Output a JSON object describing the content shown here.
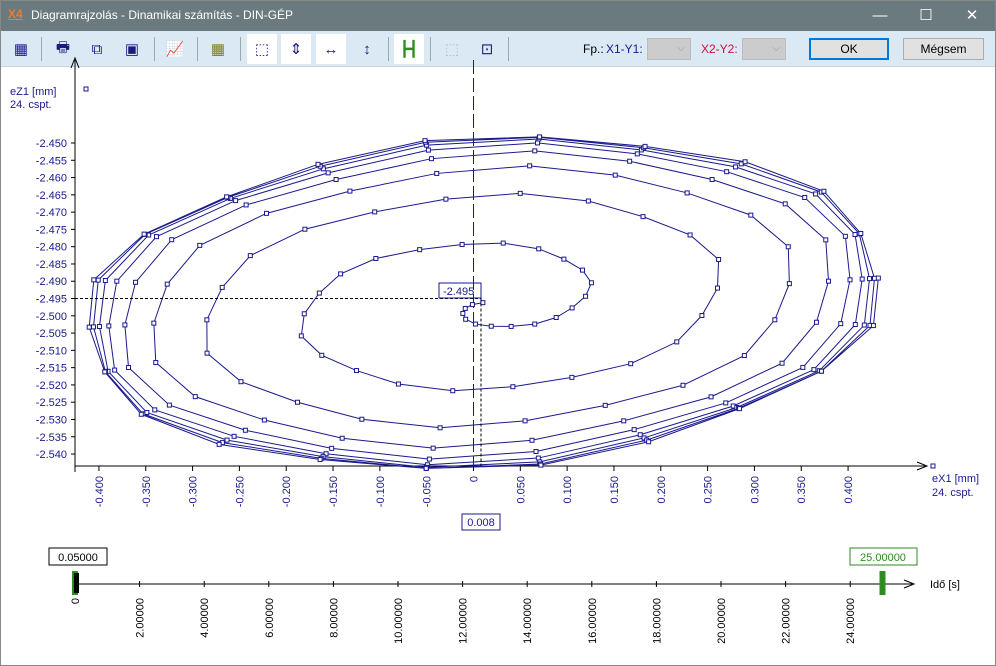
{
  "window": {
    "title": "Diagramrajzolás - Dinamikai számítás - DIN-GÉP",
    "logo": "X4",
    "minimize": "—",
    "maximize": "☐",
    "close": "✕"
  },
  "toolbar": {
    "icons": [
      "copy-icon",
      "printer-icon",
      "export-icon",
      "camera-icon",
      "chart-icon",
      "table-icon",
      "fit-both-icon",
      "fit-vertical-icon",
      "fit-horizontal-width-icon",
      "fit-vertical-height-icon",
      "time-range-icon",
      "marker-disabled-icon",
      "cursor-icon"
    ],
    "fp_label": "Fp.:",
    "x1y1_label": "X1-Y1:",
    "x2y2_label": "X2-Y2:",
    "ok": "OK",
    "cancel": "Mégsem"
  },
  "colors": {
    "series": "#1a1a8c",
    "x1y1": "#1a1a8c",
    "x2y2": "#d0103a",
    "slider": "#2e8b1f"
  },
  "chart_data": {
    "type": "line",
    "ylabel": "eZ1 [mm]",
    "ylabel_sub": "24. cspt.",
    "xlabel": "eX1 [mm]",
    "xlabel_sub": "24. cspt.",
    "xlim": [
      -0.425,
      0.445
    ],
    "ylim": [
      -2.5455,
      -2.447
    ],
    "xticks": [
      "-0.400",
      "-0.350",
      "-0.300",
      "-0.250",
      "-0.200",
      "-0.150",
      "-0.100",
      "-0.050",
      "0",
      "0.050",
      "0.100",
      "0.150",
      "0.200",
      "0.250",
      "0.300",
      "0.350",
      "0.400"
    ],
    "yticks": [
      "-2.450",
      "-2.455",
      "-2.460",
      "-2.465",
      "-2.470",
      "-2.475",
      "-2.480",
      "-2.485",
      "-2.490",
      "-2.495",
      "-2.500",
      "-2.505",
      "-2.510",
      "-2.515",
      "-2.520",
      "-2.525",
      "-2.530",
      "-2.535",
      "-2.540"
    ],
    "series": [
      {
        "model": "growing spiral to limit cycle",
        "center": [
          0.01,
          -2.4962
        ],
        "amplitude_x": 0.43,
        "amplitude_y": 0.0485,
        "points_per_turn": 22,
        "turns": 8.5,
        "growth_turns": 2.2
      }
    ],
    "cursor": {
      "x": "0.008",
      "y": "-2.495"
    }
  },
  "timeline": {
    "label": "Idő [s]",
    "start_value": "0.05000",
    "end_value": "25.00000",
    "ticks": [
      "0",
      "2.00000",
      "4.00000",
      "6.00000",
      "8.00000",
      "10.00000",
      "12.00000",
      "14.00000",
      "16.00000",
      "18.00000",
      "20.00000",
      "22.00000",
      "24.00000"
    ],
    "range": [
      0,
      25
    ]
  }
}
